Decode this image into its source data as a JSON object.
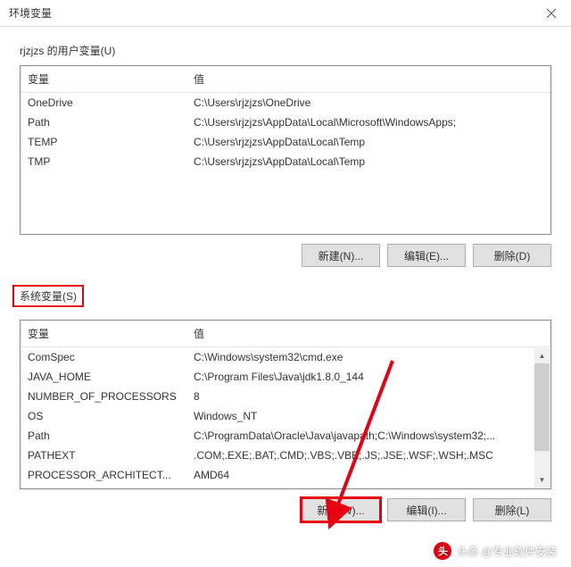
{
  "window": {
    "title": "环境变量"
  },
  "user_section": {
    "label": "rjzjzs 的用户变量(U)",
    "headers": {
      "variable": "变量",
      "value": "值"
    },
    "rows": [
      {
        "var": "OneDrive",
        "val": "C:\\Users\\rjzjzs\\OneDrive"
      },
      {
        "var": "Path",
        "val": "C:\\Users\\rjzjzs\\AppData\\Local\\Microsoft\\WindowsApps;"
      },
      {
        "var": "TEMP",
        "val": "C:\\Users\\rjzjzs\\AppData\\Local\\Temp"
      },
      {
        "var": "TMP",
        "val": "C:\\Users\\rjzjzs\\AppData\\Local\\Temp"
      }
    ],
    "buttons": {
      "new": "新建(N)...",
      "edit": "编辑(E)...",
      "delete": "删除(D)"
    }
  },
  "system_section": {
    "label": "系统变量(S)",
    "headers": {
      "variable": "变量",
      "value": "值"
    },
    "rows": [
      {
        "var": "ComSpec",
        "val": "C:\\Windows\\system32\\cmd.exe"
      },
      {
        "var": "JAVA_HOME",
        "val": "C:\\Program Files\\Java\\jdk1.8.0_144"
      },
      {
        "var": "NUMBER_OF_PROCESSORS",
        "val": "8"
      },
      {
        "var": "OS",
        "val": "Windows_NT"
      },
      {
        "var": "Path",
        "val": "C:\\ProgramData\\Oracle\\Java\\javapath;C:\\Windows\\system32;..."
      },
      {
        "var": "PATHEXT",
        "val": ".COM;.EXE;.BAT;.CMD;.VBS;.VBE;.JS;.JSE;.WSF;.WSH;.MSC"
      },
      {
        "var": "PROCESSOR_ARCHITECT...",
        "val": "AMD64"
      }
    ],
    "buttons": {
      "new": "新建(W)...",
      "edit": "编辑(I)...",
      "delete": "删除(L)"
    }
  },
  "watermark": {
    "text": "头条 @专业软件安装",
    "icon": "头"
  }
}
